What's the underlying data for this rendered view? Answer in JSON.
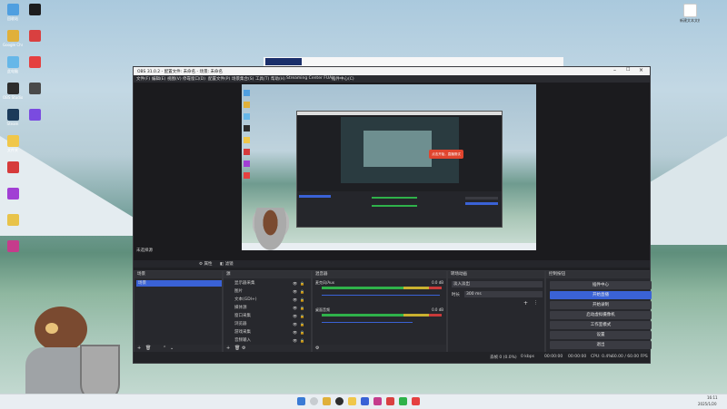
{
  "desktop": {
    "icons": [
      {
        "label": "回收站",
        "color": "#4f9fe0"
      },
      {
        "label": "Google Chrome",
        "color": "#e0b03a"
      },
      {
        "label": "此电脑",
        "color": "#66b7e8"
      },
      {
        "label": "OBS Studio",
        "color": "#2d2d2d"
      },
      {
        "label": "Steam",
        "color": "#1b3a5a"
      },
      {
        "label": "文件夹",
        "color": "#f0c74a"
      },
      {
        "label": "",
        "color": "#d63b3b"
      },
      {
        "label": "",
        "color": "#a13fd4"
      },
      {
        "label": "",
        "color": "#e8c34a"
      },
      {
        "label": "",
        "color": "#c53c8c"
      },
      {
        "label": "",
        "color": "#1d1d1d"
      },
      {
        "label": "",
        "color": "#d94040"
      },
      {
        "label": "",
        "color": "#e54040"
      },
      {
        "label": "",
        "color": "#4a4a4a"
      },
      {
        "label": "",
        "color": "#7a4be0"
      }
    ],
    "right_icon_label": "新建文本文档"
  },
  "obs": {
    "title": "OBS 31.0.2 - 配置文件: 未命名 - 场景: 未命名",
    "menus": [
      "文件(F)",
      "编辑(E)",
      "视图(V)",
      "停靠窗口(D)",
      "配置文件(P)",
      "场景集合(S)",
      "工具(T)",
      "帮助(H)",
      "Streaming Center FUA)",
      "插件中心(C)"
    ],
    "nested_popup": "点击开始，直播测试",
    "source_toolbar": [
      "属性",
      "滤镜"
    ],
    "no_source": "未选择源",
    "docks": {
      "scenes": {
        "title": "场景",
        "items": [
          "场景"
        ]
      },
      "sources": {
        "title": "源",
        "items": [
          "显示器采集",
          "图片",
          "文本(GDI+)",
          "媒体源",
          "窗口采集",
          "浏览器",
          "游戏采集",
          "音频输入"
        ]
      },
      "mixer": {
        "title": "混音器",
        "tracks": [
          {
            "name": "麦克风/Aux",
            "db": "0.0 dB"
          },
          {
            "name": "桌面音频",
            "db": "0.0 dB"
          }
        ]
      },
      "transitions": {
        "title": "转场动画",
        "type": "淡入淡出",
        "duration_label": "时长",
        "duration": "300 ms"
      },
      "controls": {
        "title": "控制按钮",
        "buttons": [
          "插件中心",
          "开始直播",
          "开始录制",
          "启动虚拟摄像机",
          "工作室模式",
          "设置",
          "退出"
        ]
      }
    },
    "status": {
      "dropped": "丢帧 0 (0.0%)",
      "bitrate": "0 kbps",
      "live": "00:00:00",
      "rec": "00:00:00",
      "cpu": "CPU: 0.4%",
      "fps": "60.00 / 60.00 FPS"
    }
  },
  "taskbar": {
    "time": "16:11",
    "date": "2025/1/20"
  },
  "colors": {
    "accent": "#3a62d6",
    "meter_green": "#2fb24a",
    "meter_yellow": "#c9b12f",
    "meter_red": "#c93a3a"
  }
}
